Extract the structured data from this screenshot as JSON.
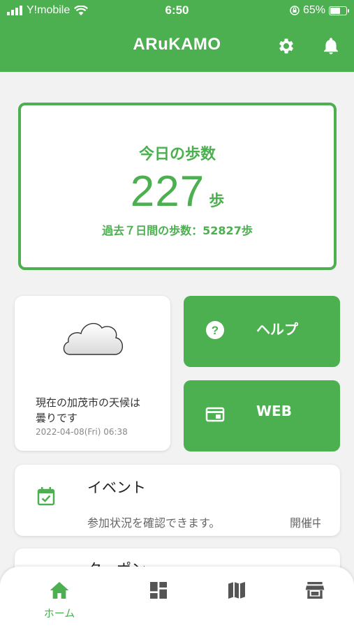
{
  "status_bar": {
    "carrier": "Y!mobile",
    "time": "6:50",
    "battery": "65%"
  },
  "header": {
    "title": "ARuKAMO",
    "icons": [
      "gear-icon",
      "bell-icon"
    ]
  },
  "steps": {
    "title": "今日の歩数",
    "count": "227",
    "unit": "歩",
    "weekly": "過去７日間の歩数：52827歩"
  },
  "weather": {
    "icon": "cloud-icon",
    "text_line1": "現在の加茂市の天候は",
    "text_line2": "曇りです",
    "timestamp": "2022-04-08(Fri) 06:38"
  },
  "buttons": {
    "help_label": "ヘルプ",
    "web_label": "WEB"
  },
  "event": {
    "title": "イベント",
    "description": "参加状況を確認できます。",
    "tag": "開催中"
  },
  "coupon": {
    "title": "クーポン"
  },
  "tabbar": {
    "home_label": "ホーム",
    "icons": [
      "home-icon",
      "dashboard-icon",
      "map-icon",
      "store-icon"
    ]
  },
  "colors": {
    "brand": "#4caf50",
    "background": "#f2f2f2"
  }
}
